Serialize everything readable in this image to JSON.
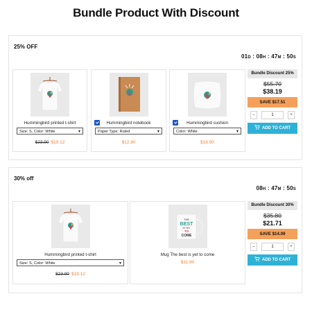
{
  "page": {
    "title": "Bundle Product With Discount"
  },
  "bundles": [
    {
      "title": "25% OFF",
      "timer": {
        "d": "01",
        "h": "08",
        "m": "47",
        "s": "50"
      },
      "products": [
        {
          "name": "Hummingbird printed t-shirt",
          "option": "Size: S, Color: White",
          "old_price": "$23.90",
          "new_price": "$19.12"
        },
        {
          "name": "Hummingbird notebook",
          "option": "Paper Type: Ruled",
          "new_price": "$12.90"
        },
        {
          "name": "Hummingbird cushion",
          "option": "Color: White",
          "new_price": "$18.90"
        }
      ],
      "discount_label": "Bundle Discount 25%",
      "old_total": "$55.70",
      "new_total": "$38.19",
      "save_label": "SAVE $17.51",
      "qty": "1",
      "minus": "–",
      "plus": "+",
      "cart_label": "ADD TO CART"
    },
    {
      "title": "30% off",
      "timer": {
        "h": "08",
        "m": "47",
        "s": "50"
      },
      "products": [
        {
          "name": "Hummingbird printed t-shirt",
          "option": "Size: S, Color: White",
          "old_price": "$23.90",
          "new_price": "$19.12"
        },
        {
          "name": "Mug The best is yet to come",
          "new_price": "$11.90",
          "mug_text": [
            "THE",
            "BEST",
            "IS YET",
            "TO",
            "COME"
          ]
        }
      ],
      "discount_label": "Bundle Discount 30%",
      "old_total": "$35.80",
      "new_total": "$21.71",
      "save_label": "SAVE $14.09",
      "qty": "1",
      "minus": "–",
      "plus": "+",
      "cart_label": "ADD TO CART"
    }
  ],
  "units": {
    "d": "D",
    "h": "H",
    "m": "M",
    "s": "S",
    "sep": ":"
  },
  "colors": {
    "accent_orange": "#f0833a",
    "save_bg": "#f4a05a",
    "cart_bg": "#2fb1d6",
    "checkbox": "#1a56c4"
  },
  "icons": {
    "cart": "cart-icon",
    "select_arrow": "chevron-down-icon",
    "checkbox": "checkbox-checked-icon"
  }
}
